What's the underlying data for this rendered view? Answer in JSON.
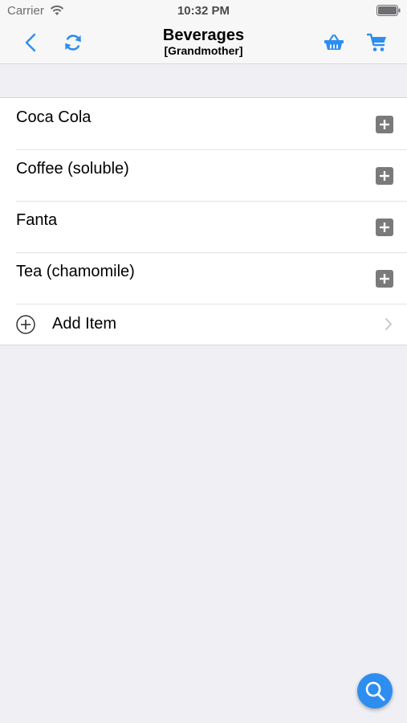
{
  "status_bar": {
    "carrier": "Carrier",
    "time": "10:32 PM"
  },
  "nav": {
    "title": "Beverages",
    "subtitle": "[Grandmother]"
  },
  "items": [
    {
      "label": "Coca Cola"
    },
    {
      "label": "Coffee (soluble)"
    },
    {
      "label": "Fanta"
    },
    {
      "label": "Tea (chamomile)"
    }
  ],
  "add_item": {
    "label": "Add Item"
  },
  "colors": {
    "accent": "#2d8ef0",
    "plus_button": "#7a7a7a",
    "background": "#efeff4"
  },
  "icons": {
    "back": "chevron-left-icon",
    "refresh": "refresh-icon",
    "basket": "basket-icon",
    "cart": "shopping-cart-icon",
    "add": "plus-square-icon",
    "add_circle": "plus-circle-icon",
    "disclosure": "chevron-right-icon",
    "search": "search-icon"
  }
}
